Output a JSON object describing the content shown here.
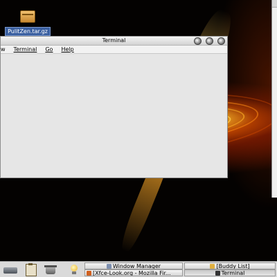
{
  "desktop": {
    "icons": [
      {
        "label": "PulitZen.tar.gz",
        "icon": "tarball-icon"
      }
    ]
  },
  "terminal_window": {
    "title": "Terminal",
    "menu": [
      "w",
      "Terminal",
      "Go",
      "Help"
    ],
    "title_buttons": [
      "minimize-icon",
      "maximize-icon",
      "close-icon"
    ]
  },
  "panel": {
    "launchers": [
      "drive-icon",
      "clipboard-icon",
      "trash-icon",
      "lightbulb-icon"
    ],
    "taskbar": [
      {
        "label": "Window Manager",
        "icon": "settings-icon"
      },
      {
        "label": "[Xfce-Look.org - Mozilla Fir...",
        "icon": "browser-icon"
      },
      {
        "label": "[Buddy List]",
        "icon": "buddy-icon"
      },
      {
        "label": "Terminal",
        "icon": "terminal-icon",
        "active": true
      }
    ]
  }
}
